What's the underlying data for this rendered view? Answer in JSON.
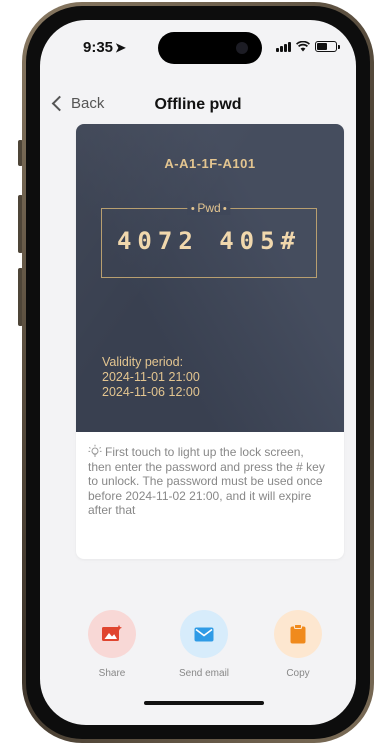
{
  "status": {
    "time": "9:35"
  },
  "nav": {
    "back_label": "Back",
    "title": "Offline pwd"
  },
  "card": {
    "room": "A-A1-1F-A101",
    "pwd_label": "Pwd",
    "pwd_value": "4072 405#",
    "validity_title": "Validity period:",
    "validity_start": "2024-11-01 21:00",
    "validity_end": "2024-11-06 12:00",
    "tip": "First touch to light up the lock screen, then enter the password and press the # key to unlock. The password must be used once before 2024-11-02 21:00, and it will expire after that"
  },
  "actions": [
    {
      "label": "Share",
      "icon": "share-image-icon",
      "color": "#e0452f",
      "bg": "#f8d8d6"
    },
    {
      "label": "Send email",
      "icon": "mail-icon",
      "color": "#2f9be6",
      "bg": "#d7ecfb"
    },
    {
      "label": "Copy",
      "icon": "clipboard-icon",
      "color": "#f08a1c",
      "bg": "#fde7d0"
    }
  ],
  "colors": {
    "card_bg": "#3f4759",
    "gold_text": "#e3c590",
    "page_bg": "#f3f3f5"
  }
}
